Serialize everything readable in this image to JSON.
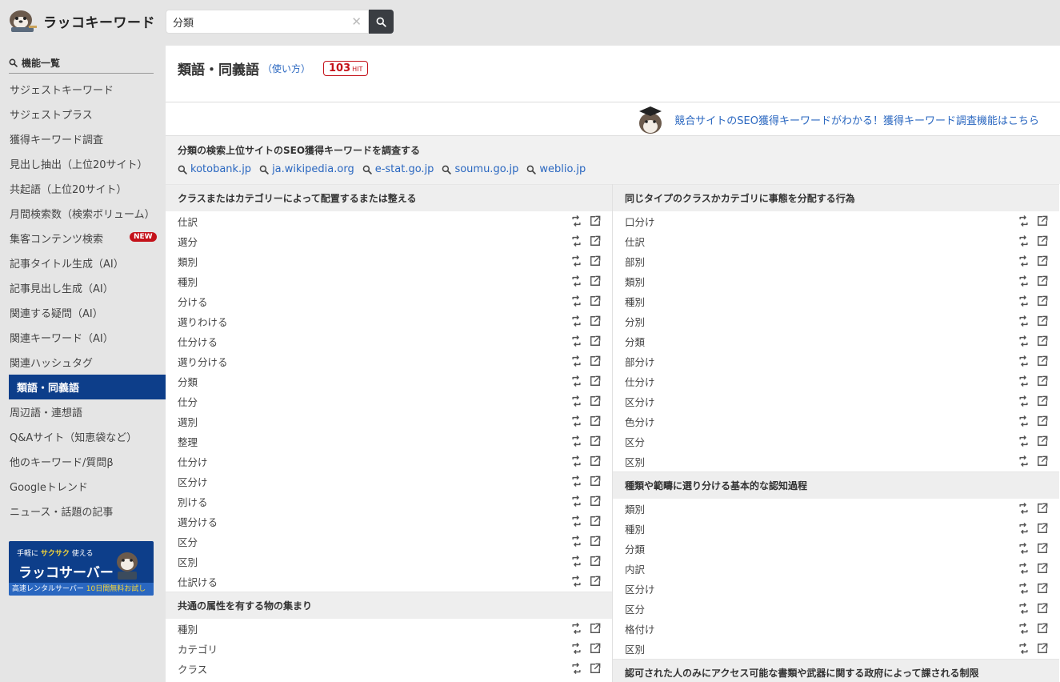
{
  "header": {
    "logo_text": "ラッコキーワード",
    "search_value": "分類"
  },
  "sidebar": {
    "heading": "機能一覧",
    "items": [
      {
        "label": "サジェストキーワード"
      },
      {
        "label": "サジェストプラス"
      },
      {
        "label": "獲得キーワード調査"
      },
      {
        "label": "見出し抽出（上位20サイト）"
      },
      {
        "label": "共起語（上位20サイト）"
      },
      {
        "label": "月間検索数（検索ボリューム）"
      },
      {
        "label": "集客コンテンツ検索",
        "badge": "NEW"
      },
      {
        "label": "記事タイトル生成（AI）"
      },
      {
        "label": "記事見出し生成（AI）"
      },
      {
        "label": "関連する疑問（AI）"
      },
      {
        "label": "関連キーワード（AI）"
      },
      {
        "label": "関連ハッシュタグ"
      },
      {
        "label": "類語・同義語",
        "active": true
      },
      {
        "label": "周辺語・連想語"
      },
      {
        "label": "Q&Aサイト（知恵袋など）"
      },
      {
        "label": "他のキーワード/質問β"
      },
      {
        "label": "Googleトレンド"
      },
      {
        "label": "ニュース・話題の記事"
      }
    ],
    "banner": {
      "top_prefix": "手軽に",
      "top_highlight": "サクサク",
      "top_suffix": "使える",
      "title": "ラッコサーバー",
      "foot_prefix": "高速レンタルサーバー",
      "foot_highlight": "10日間無料お試し"
    }
  },
  "main": {
    "title": "類語・同義語",
    "howto": "（使い方）",
    "hit_count": "103",
    "hit_unit": "HIT",
    "promo": "競合サイトのSEO獲得キーワードがわかる！獲得キーワード調査機能はこちら",
    "seo_title": "分類の検索上位サイトのSEO獲得キーワードを調査する",
    "seo_sites": [
      "kotobank.jp",
      "ja.wikipedia.org",
      "e-stat.go.jp",
      "soumu.go.jp",
      "weblio.jp"
    ]
  },
  "left_groups": [
    {
      "heading": "クラスまたはカテゴリーによって配置するまたは整える",
      "words": [
        "仕訳",
        "選分",
        "類別",
        "種別",
        "分ける",
        "選りわける",
        "仕分ける",
        "選り分ける",
        "分類",
        "仕分",
        "選別",
        "整理",
        "仕分け",
        "区分け",
        "別ける",
        "選分ける",
        "区分",
        "区別",
        "仕訳ける"
      ]
    },
    {
      "heading": "共通の属性を有する物の集まり",
      "words": [
        "種別",
        "カテゴリ",
        "クラス"
      ]
    }
  ],
  "right_groups": [
    {
      "heading": "同じタイプのクラスかカテゴリに事態を分配する行為",
      "words": [
        "口分け",
        "仕訳",
        "部別",
        "類別",
        "種別",
        "分別",
        "分類",
        "部分け",
        "仕分け",
        "区分け",
        "色分け",
        "区分",
        "区別"
      ]
    },
    {
      "heading": "種類や範疇に選り分ける基本的な認知過程",
      "words": [
        "類別",
        "種別",
        "分類",
        "内訳",
        "区分け",
        "区分",
        "格付け",
        "区別"
      ]
    },
    {
      "heading": "認可された人のみにアクセス可能な書類や武器に関する政府によって課される制限",
      "words": []
    }
  ]
}
